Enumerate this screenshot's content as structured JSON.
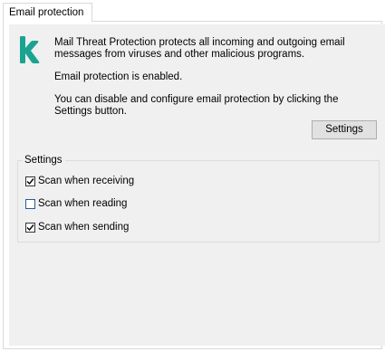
{
  "tab": {
    "label": "Email protection"
  },
  "description": {
    "main": "Mail Threat Protection protects all incoming and outgoing email messages from viruses and other malicious programs.",
    "status": "Email protection is enabled.",
    "hint": "You can disable and configure email protection by clicking the Settings button."
  },
  "buttons": {
    "settings_label": "Settings"
  },
  "settings_group": {
    "title": "Settings",
    "options": [
      {
        "label": "Scan when receiving",
        "checked": true
      },
      {
        "label": "Scan when reading",
        "checked": false
      },
      {
        "label": "Scan when sending",
        "checked": true
      }
    ]
  },
  "colors": {
    "brand_green": "#1ba391",
    "panel_bg": "#f0f0f0",
    "button_bg": "#e1e1e1"
  },
  "icons": {
    "logo": "kaspersky-k-logo-icon",
    "check": "checkmark-icon"
  }
}
